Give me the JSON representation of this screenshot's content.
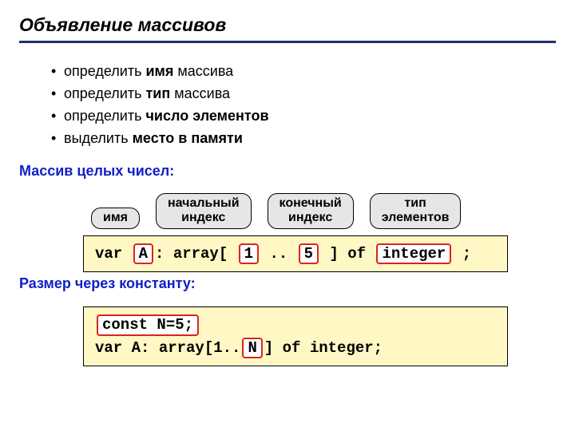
{
  "title": "Объявление массивов",
  "bullets": [
    {
      "pre": "определить ",
      "strong": "имя",
      "post": " массива"
    },
    {
      "pre": "определить ",
      "strong": "тип",
      "post": " массива"
    },
    {
      "pre": "определить ",
      "strong": "число элементов",
      "post": ""
    },
    {
      "pre": "выделить ",
      "strong": "место в памяти",
      "post": ""
    }
  ],
  "subhead1": "Массив целых чисел:",
  "labels": {
    "name": "имя",
    "start": "начальный\nиндекс",
    "end": "конечный\nиндекс",
    "type": "тип\nэлементов"
  },
  "code1": {
    "t1": "var ",
    "a": "A",
    "t2": ": array[ ",
    "one": "1",
    "t3": " .. ",
    "five": "5",
    "t4": " ] of ",
    "int": "integer",
    "t5": " ;"
  },
  "subhead2": "Размер через константу:",
  "code2": {
    "const": "const N=5;",
    "line2a": "var A: array[1..",
    "n": "N",
    "line2b": "] of integer;"
  }
}
